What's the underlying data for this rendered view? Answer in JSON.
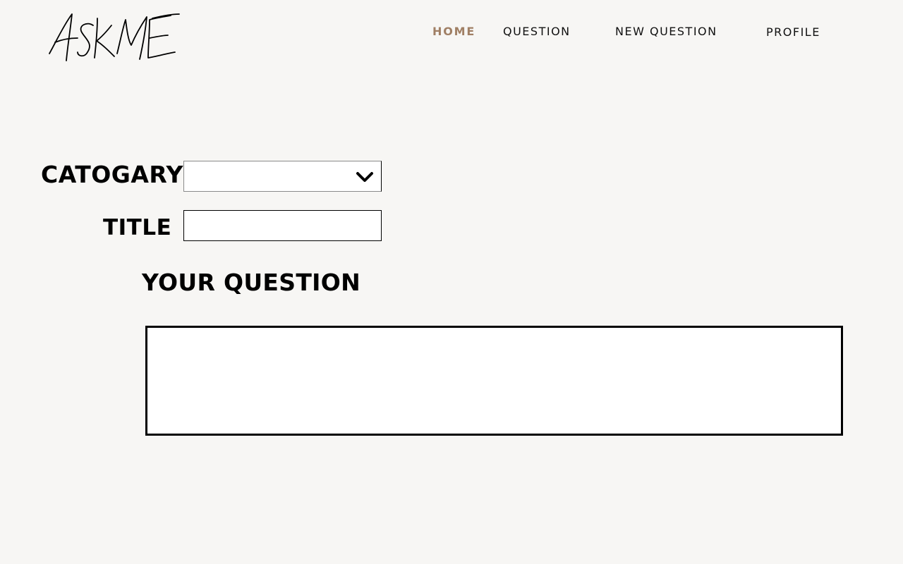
{
  "brand": {
    "logo_text": "ASKME"
  },
  "nav": {
    "home": "HOME",
    "question": "QUESTION",
    "new_question": "NEW QUESTION",
    "profile": "PROFILE",
    "active": "home",
    "active_color": "#a07f64"
  },
  "form": {
    "category_label": "CATOGARY",
    "category_value": "",
    "category_icon": "chevron-down-icon",
    "title_label": "TITLE",
    "title_value": "",
    "title_placeholder": "",
    "question_label": "YOUR QUESTION",
    "question_value": "",
    "question_placeholder": ""
  },
  "colors": {
    "background": "#f7f6f4",
    "text": "#000000",
    "field_background": "#ffffff"
  }
}
